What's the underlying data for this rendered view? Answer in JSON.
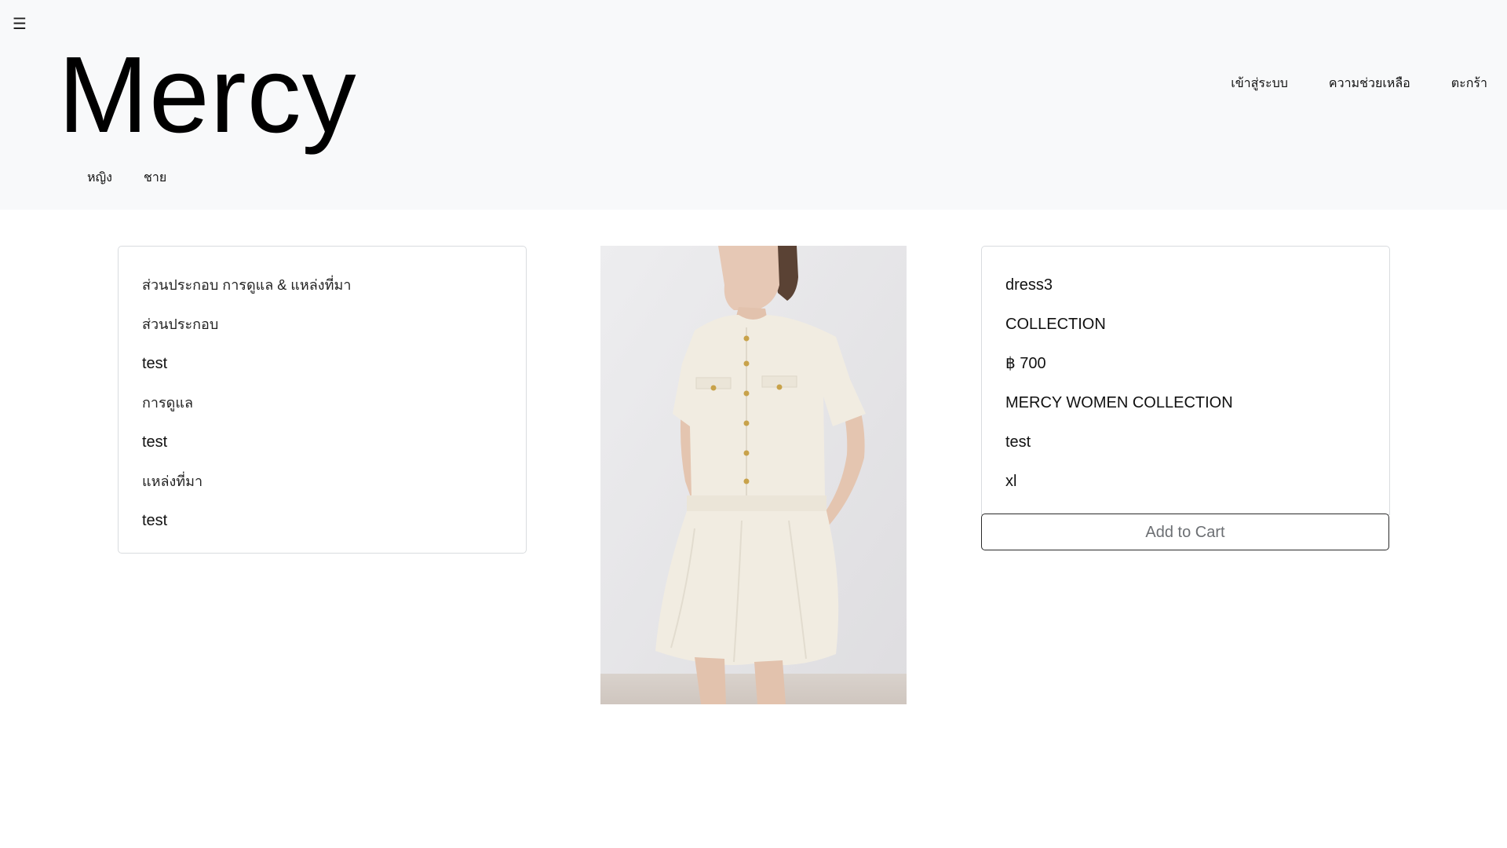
{
  "header": {
    "menu_icon": "hamburger-icon",
    "menu_glyph": "☰",
    "logo": "Mercy",
    "categories": [
      {
        "label": "หญิง"
      },
      {
        "label": "ชาย"
      }
    ],
    "links": [
      {
        "label": "เข้าสู่ระบบ"
      },
      {
        "label": "ความช่วยเหลือ"
      },
      {
        "label": "ตะกร้า"
      }
    ]
  },
  "details": {
    "heading": "ส่วนประกอบ การดูแล & แหล่งที่มา",
    "composition_label": "ส่วนประกอบ",
    "composition_value": "test",
    "care_label": "การดูแล",
    "care_value": "test",
    "origin_label": "แหล่งที่มา",
    "origin_value": "test"
  },
  "product": {
    "name": "dress3",
    "collection_label": "COLLECTION",
    "price": "฿ 700",
    "collection": "MERCY WOMEN COLLECTION",
    "description": "test",
    "size": "xl",
    "add_to_cart_label": "Add to Cart"
  },
  "colors": {
    "header_bg": "#f8f9fa",
    "dress": "#f1ece1",
    "buttons_gold": "#c8a24a"
  }
}
